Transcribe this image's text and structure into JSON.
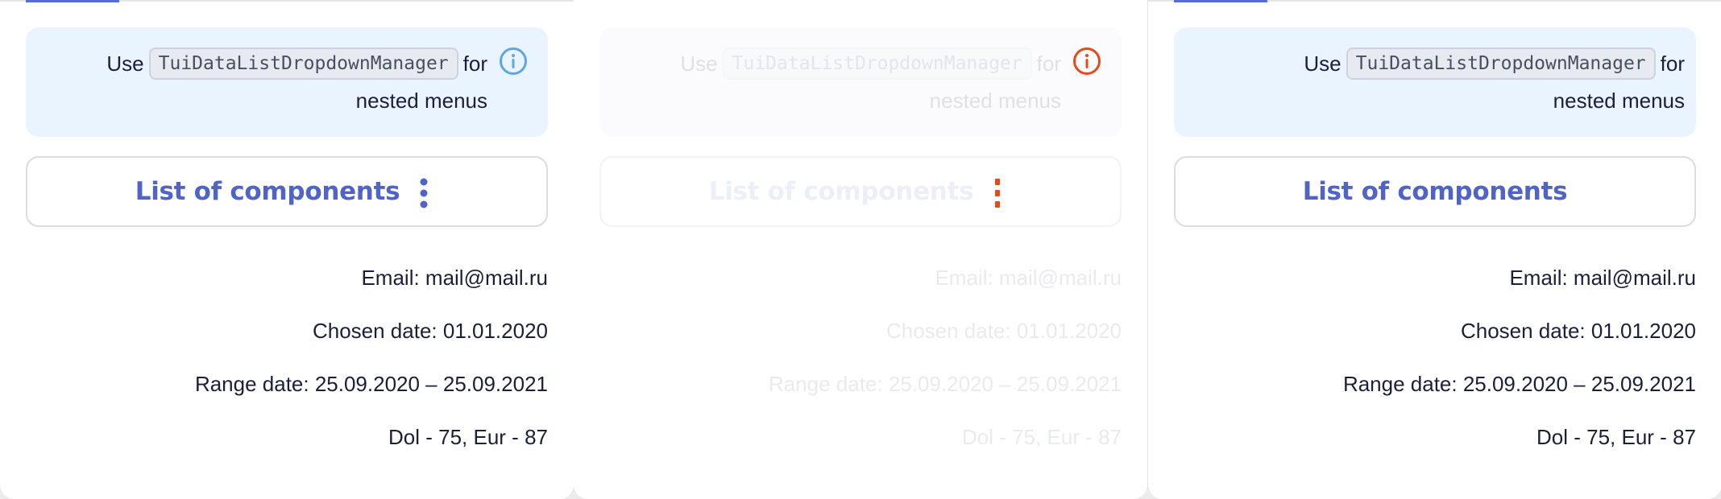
{
  "panels": [
    {
      "hint": {
        "prefix": "Use",
        "code": "TuiDataListDropdownManager",
        "suffix": "for",
        "second_line": "nested menus",
        "icon": "info-icon",
        "icon_color": "#5ea5e8"
      },
      "button": {
        "label": "List of components",
        "has_more": true,
        "more_color": "#5064c6"
      },
      "info": {
        "email": "Email: mail@mail.ru",
        "chosen_date": "Chosen date: 01.01.2020",
        "range_date": "Range date: 25.09.2020 – 25.09.2021",
        "currency": "Dol - 75, Eur - 87"
      }
    },
    {
      "hint": {
        "prefix": "Use",
        "code": "TuiDataListDropdownManager",
        "suffix": "for",
        "second_line": "nested menus",
        "icon": "info-icon",
        "icon_color": "#e64a19"
      },
      "button": {
        "label": "List of components",
        "has_more": true,
        "more_color": "#e64a19"
      },
      "info": {
        "email": "Email: mail@mail.ru",
        "chosen_date": "Chosen date: 01.01.2020",
        "range_date": "Range date: 25.09.2020 – 25.09.2021",
        "currency": "Dol - 75, Eur - 87"
      }
    },
    {
      "hint": {
        "prefix": "Use",
        "code": "TuiDataListDropdownManager",
        "suffix": "for",
        "second_line": "nested menus"
      },
      "button": {
        "label": "List of components",
        "has_more": false
      },
      "info": {
        "email": "Email: mail@mail.ru",
        "chosen_date": "Chosen date: 01.01.2020",
        "range_date": "Range date: 25.09.2020 – 25.09.2021",
        "currency": "Dol - 75, Eur - 87"
      }
    }
  ],
  "colors": {
    "accent": "#5064c6",
    "tab_indicator": "#526ed3",
    "hint_background": "#eaf4fe",
    "text": "#1b1f3b"
  }
}
